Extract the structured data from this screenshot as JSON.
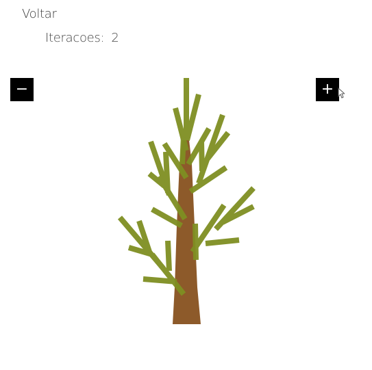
{
  "nav": {
    "back_label": "Voltar"
  },
  "iterations": {
    "label": "Iteracoes:",
    "value": "2"
  },
  "controls": {
    "decrease_label": "−",
    "increase_label": "+"
  },
  "colors": {
    "trunk": "#8d5a2a",
    "branch": "#7f8f22",
    "branch_dark": "#6b7d1f",
    "button_bg": "#000000",
    "button_fg": "#ffffff"
  },
  "icons": {
    "cursor": "mouse-cursor-icon"
  }
}
